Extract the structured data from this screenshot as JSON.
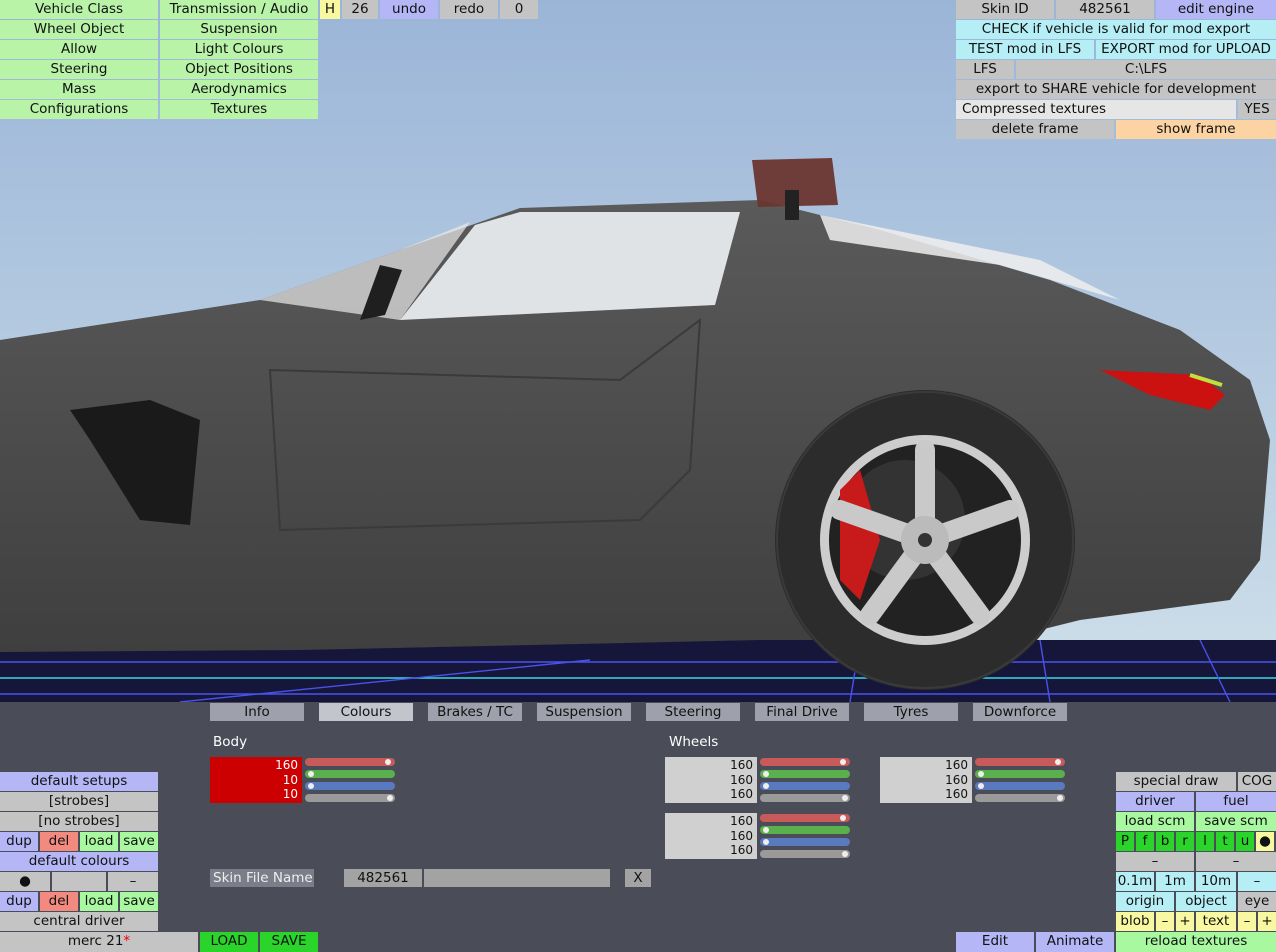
{
  "menu_left": {
    "col1": [
      "Vehicle Class",
      "Wheel Object",
      "Allow",
      "Steering",
      "Mass",
      "Configurations"
    ],
    "col2": [
      "Transmission / Audio",
      "Suspension",
      "Light Colours",
      "Object Positions",
      "Aerodynamics",
      "Textures"
    ]
  },
  "top_toolbar": {
    "h": "H",
    "count": "26",
    "undo": "undo",
    "redo": "redo",
    "zero": "0"
  },
  "top_right": {
    "skin_id_label": "Skin ID",
    "skin_id_value": "482561",
    "edit_engine": "edit engine",
    "check_valid": "CHECK if vehicle is valid for mod export",
    "test_mod": "TEST mod in LFS",
    "export_mod": "EXPORT mod for UPLOAD",
    "lfs_label": "LFS",
    "lfs_path": "C:\\LFS",
    "export_share": "export to SHARE vehicle for development",
    "compressed_textures": "Compressed textures",
    "compressed_value": "YES",
    "delete_frame": "delete frame",
    "show_frame": "show frame"
  },
  "tabs": [
    "Info",
    "Colours",
    "Brakes / TC",
    "Suspension",
    "Steering",
    "Final Drive",
    "Tyres",
    "Downforce"
  ],
  "active_tab": "Colours",
  "colours": {
    "body_label": "Body",
    "body": [
      "160",
      "10",
      "10"
    ],
    "body_color": "#cc0000",
    "wheels_label": "Wheels",
    "wheel1": [
      "160",
      "160",
      "160"
    ],
    "wheel2": [
      "160",
      "160",
      "160"
    ],
    "wheel3": [
      "160",
      "160",
      "160"
    ],
    "skin_file_label": "Skin File Name",
    "skin_file_value": "482561",
    "clear": "X"
  },
  "left_panel": {
    "default_setups": "default setups",
    "strobes": "[strobes]",
    "no_strobes": "[no strobes]",
    "dup": "dup",
    "del": "del",
    "load": "load",
    "save": "save",
    "default_colours": "default colours",
    "dot": "●",
    "minus": "–",
    "central_driver": "central driver"
  },
  "bottom_bar": {
    "vehicle_name": "merc 21",
    "modified_marker": "*",
    "load": "LOAD",
    "save": "SAVE",
    "edit": "Edit",
    "animate": "Animate",
    "reload_textures": "reload textures"
  },
  "right_panel": {
    "special_draw": "special draw",
    "cog": "COG",
    "driver": "driver",
    "fuel": "fuel",
    "load_scm": "load scm",
    "save_scm": "save scm",
    "letters": [
      "P",
      "f",
      "b",
      "r",
      "l",
      "t",
      "u",
      "●"
    ],
    "dash": "–",
    "scale": [
      "0.1m",
      "1m",
      "10m",
      "–"
    ],
    "origin": "origin",
    "object": "object",
    "eye": "eye",
    "blob": "blob",
    "text": "text",
    "minus": "–",
    "plus": "+"
  },
  "colors": {
    "body": "#cc0000",
    "sky_top": "#9db6d6",
    "car": "#4f4f4f",
    "panel": "#4a4d58"
  }
}
